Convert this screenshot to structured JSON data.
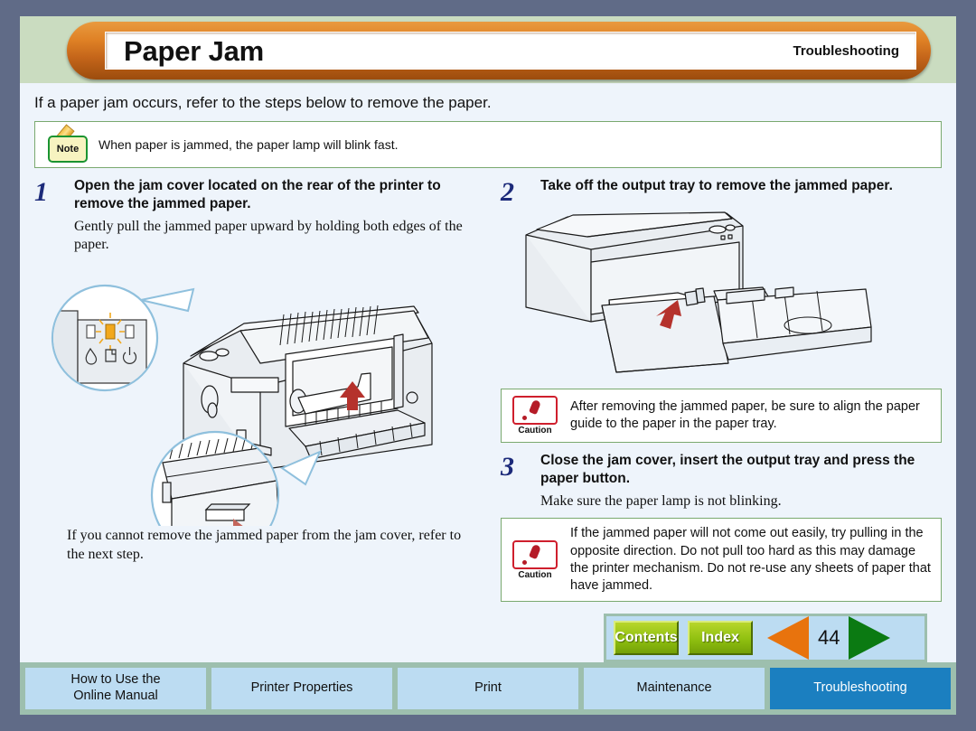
{
  "header": {
    "title": "Paper Jam",
    "section": "Troubleshooting"
  },
  "intro": "If a paper jam occurs, refer to the steps below to remove the paper.",
  "note": {
    "icon": "note-pencil-icon",
    "label": "Note",
    "text": "When paper is jammed, the paper lamp will blink fast."
  },
  "steps": [
    {
      "number": "1",
      "heading": "Open the jam cover located on the rear of the printer to remove the jammed paper.",
      "body": "Gently pull the jammed paper upward by holding both edges of the paper.",
      "tail": "If you cannot remove the jammed paper from the jam cover, refer to the next step."
    },
    {
      "number": "2",
      "heading": "Take off the output tray to remove the jammed paper."
    },
    {
      "number": "3",
      "heading": "Close the jam cover, insert the output tray and press the paper button.",
      "body": "Make sure the paper lamp is not blinking."
    }
  ],
  "cautions": [
    {
      "label": "Caution",
      "text": "After removing the jammed paper, be sure to align the paper guide to the paper in the paper tray."
    },
    {
      "label": "Caution",
      "text": "If the jammed paper will not come out easily, try pulling in the opposite direction. Do not pull too hard as this may damage the printer mechanism. Do not re-use any sheets of paper that have jammed."
    }
  ],
  "nav": {
    "contents_label": "Contents",
    "index_label": "Index",
    "prev_icon": "previous-page-triangle-icon",
    "next_icon": "next-page-triangle-icon",
    "page_number": "44"
  },
  "tabs": [
    {
      "label": "How to Use the\nOnline Manual",
      "active": false
    },
    {
      "label": "Printer Properties",
      "active": false
    },
    {
      "label": "Print",
      "active": false
    },
    {
      "label": "Maintenance",
      "active": false
    },
    {
      "label": "Troubleshooting",
      "active": true
    }
  ],
  "illustrations": {
    "step1": {
      "name": "printer-rear-jam-cover-illustration",
      "callout_lamp": "paper-lamp-blinking-callout",
      "callout_cover": "jam-cover-release-callout",
      "lamp_icons": [
        "ink-drop-icon",
        "paper-sheet-icon",
        "power-icon"
      ]
    },
    "step2": {
      "name": "printer-output-tray-illustration"
    }
  },
  "colors": {
    "frame": "#606b87",
    "page_bg": "#eef4fb",
    "header_band": "#cadcc0",
    "title_orange": "#df8125",
    "box_border_green": "#7aa96f",
    "step_number_blue": "#1c2a7a",
    "caution_red": "#cf1f2d",
    "tab_bar_green": "#9dbfae",
    "tab_blue": "#bcdcf2",
    "tab_active_blue": "#1b7fc0",
    "button_green": "#8fc010",
    "prev_orange": "#e8730d",
    "next_green": "#0b7a12",
    "arrow_red": "#b5322c"
  }
}
